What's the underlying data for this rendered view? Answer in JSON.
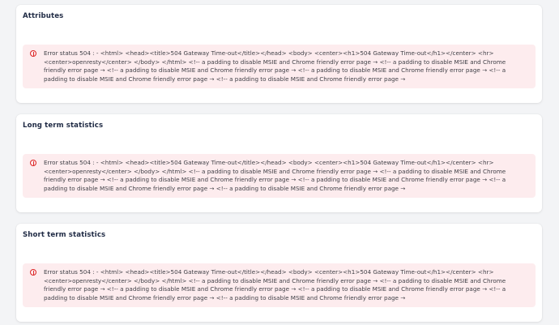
{
  "colors": {
    "background": "#f3f4f6",
    "card": "#ffffff",
    "alert_bg": "#fdecee",
    "alert_icon": "#dc2626",
    "title": "#1f2a44"
  },
  "sections": [
    {
      "title": "Attributes",
      "error": "Error status 504 : - <html> <head><title>504 Gateway Time-out</title></head> <body> <center><h1>504 Gateway Time-out</h1></center> <hr> <center>openresty</center> </body> </html> <!-- a padding to disable MSIE and Chrome friendly error page → <!-- a padding to disable MSIE and Chrome friendly error page → <!-- a padding to disable MSIE and Chrome friendly error page → <!-- a padding to disable MSIE and Chrome friendly error page → <!-- a padding to disable MSIE and Chrome friendly error page → <!-- a padding to disable MSIE and Chrome friendly error page →"
    },
    {
      "title": "Long term statistics",
      "error": "Error status 504 : - <html> <head><title>504 Gateway Time-out</title></head> <body> <center><h1>504 Gateway Time-out</h1></center> <hr> <center>openresty</center> </body> </html> <!-- a padding to disable MSIE and Chrome friendly error page → <!-- a padding to disable MSIE and Chrome friendly error page → <!-- a padding to disable MSIE and Chrome friendly error page → <!-- a padding to disable MSIE and Chrome friendly error page → <!-- a padding to disable MSIE and Chrome friendly error page → <!-- a padding to disable MSIE and Chrome friendly error page →"
    },
    {
      "title": "Short term statistics",
      "error": "Error status 504 : - <html> <head><title>504 Gateway Time-out</title></head> <body> <center><h1>504 Gateway Time-out</h1></center> <hr> <center>openresty</center> </body> </html> <!-- a padding to disable MSIE and Chrome friendly error page → <!-- a padding to disable MSIE and Chrome friendly error page → <!-- a padding to disable MSIE and Chrome friendly error page → <!-- a padding to disable MSIE and Chrome friendly error page → <!-- a padding to disable MSIE and Chrome friendly error page → <!-- a padding to disable MSIE and Chrome friendly error page →"
    }
  ]
}
